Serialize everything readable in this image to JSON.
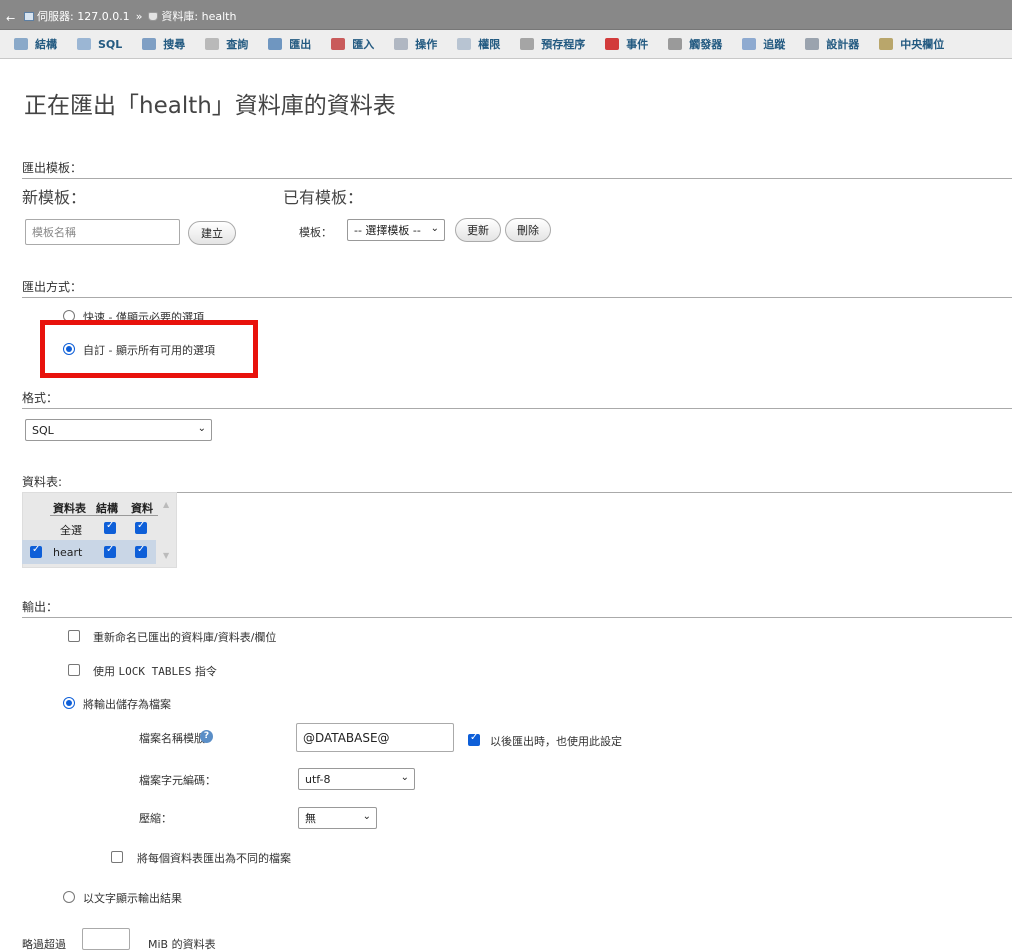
{
  "breadcrumb": {
    "server": "伺服器: 127.0.0.1",
    "separator": "»",
    "database": "資料庫: health"
  },
  "tabs": [
    {
      "name": "structure",
      "label": "結構",
      "icon": "structure-icon",
      "color": "#8aa9c9"
    },
    {
      "name": "sql",
      "label": "SQL",
      "icon": "sql-icon",
      "color": "#9bb6d4"
    },
    {
      "name": "search",
      "label": "搜尋",
      "icon": "search-icon",
      "color": "#7f9fc4"
    },
    {
      "name": "query",
      "label": "查詢",
      "icon": "query-icon",
      "color": "#b9b9b9"
    },
    {
      "name": "export",
      "label": "匯出",
      "icon": "export-icon",
      "color": "#6f96c0"
    },
    {
      "name": "import",
      "label": "匯入",
      "icon": "import-icon",
      "color": "#c95b5b"
    },
    {
      "name": "operations",
      "label": "操作",
      "icon": "wrench-icon",
      "color": "#b0b7c2"
    },
    {
      "name": "privileges",
      "label": "權限",
      "icon": "privileges-icon",
      "color": "#b8c4d2"
    },
    {
      "name": "routines",
      "label": "預存程序",
      "icon": "routines-icon",
      "color": "#a5a5a5"
    },
    {
      "name": "events",
      "label": "事件",
      "icon": "clock-icon",
      "color": "#d23b3b"
    },
    {
      "name": "triggers",
      "label": "觸發器",
      "icon": "triggers-icon",
      "color": "#9a9a9a"
    },
    {
      "name": "tracking",
      "label": "追蹤",
      "icon": "eye-icon",
      "color": "#8eaad0"
    },
    {
      "name": "designer",
      "label": "設計器",
      "icon": "designer-icon",
      "color": "#9aa3ae"
    },
    {
      "name": "central-columns",
      "label": "中央欄位",
      "icon": "central-columns-icon",
      "color": "#b9a66b"
    }
  ],
  "page_title": "正在匯出「health」資料庫的資料表",
  "templates": {
    "section": "匯出模板：",
    "new_heading": "新模板：",
    "existing_heading": "已有模板：",
    "name_placeholder": "模板名稱",
    "create_button": "建立",
    "template_label": "模板：",
    "template_select": "-- 選擇模板 --",
    "update_button": "更新",
    "delete_button": "刪除"
  },
  "method": {
    "section": "匯出方式：",
    "quick": "快速 - 僅顯示必要的選項",
    "custom": "自訂 - 顯示所有可用的選項",
    "selected": "custom"
  },
  "format": {
    "section": "格式：",
    "value": "SQL"
  },
  "tables": {
    "section": "資料表:",
    "col_table": "資料表",
    "col_structure": "結構",
    "col_data": "資料",
    "select_all": "全選",
    "rows": [
      {
        "name": "heart",
        "selected": true,
        "structure": true,
        "data": true
      }
    ]
  },
  "output": {
    "section": "輸出：",
    "rename_label": "重新命名已匯出的資料庫/資料表/欄位",
    "lock_prefix": "使用",
    "lock_code": "LOCK TABLES",
    "lock_suffix": "指令",
    "save_file_label": "將輸出儲存為檔案",
    "filename_template_label": "檔案名稱模版：",
    "filename_template_value": "@DATABASE@",
    "remember_label": "以後匯出時，也使用此設定",
    "charset_label": "檔案字元編碼：",
    "charset_value": "utf-8",
    "compression_label": "壓縮：",
    "compression_value": "無",
    "separate_files_label": "將每個資料表匯出為不同的檔案",
    "text_output_label": "以文字顯示輸出結果",
    "skip_prefix": "略過超過",
    "skip_suffix": "MiB 的資料表"
  }
}
